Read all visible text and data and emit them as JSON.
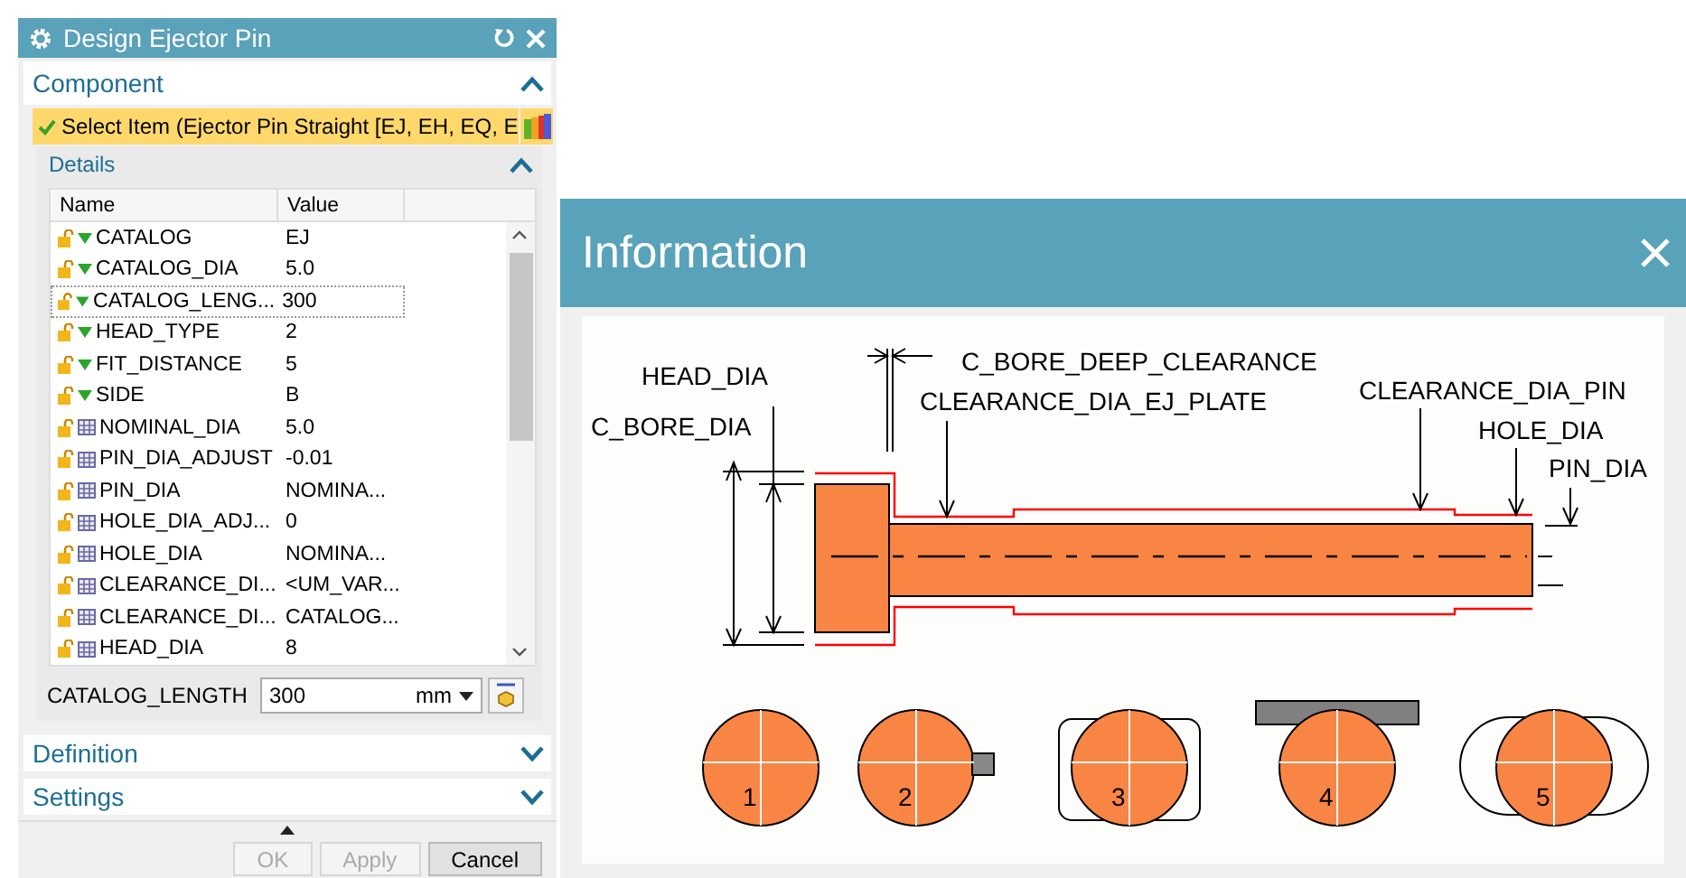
{
  "dialog": {
    "title": "Design Ejector Pin",
    "component": {
      "title": "Component",
      "expanded": true,
      "select_item": {
        "label": "Select Item (Ejector Pin Straight [EJ, EH, EQ, E",
        "done": true
      }
    },
    "details": {
      "title": "Details",
      "expanded": true,
      "columns": [
        "Name",
        "Value"
      ],
      "rows": [
        {
          "name": "CATALOG",
          "value": "EJ",
          "kind": "expression",
          "selected": false
        },
        {
          "name": "CATALOG_DIA",
          "value": "5.0",
          "kind": "expression",
          "selected": false
        },
        {
          "name": "CATALOG_LENG...",
          "value": "300",
          "kind": "expression",
          "selected": true
        },
        {
          "name": "HEAD_TYPE",
          "value": "2",
          "kind": "expression",
          "selected": false
        },
        {
          "name": "FIT_DISTANCE",
          "value": "5",
          "kind": "expression",
          "selected": false
        },
        {
          "name": "SIDE",
          "value": "B",
          "kind": "expression",
          "selected": false
        },
        {
          "name": "NOMINAL_DIA",
          "value": "5.0",
          "kind": "formula",
          "selected": false
        },
        {
          "name": "PIN_DIA_ADJUST",
          "value": "-0.01",
          "kind": "formula",
          "selected": false
        },
        {
          "name": "PIN_DIA",
          "value": "NOMINA...",
          "kind": "formula",
          "selected": false
        },
        {
          "name": "HOLE_DIA_ADJ...",
          "value": "0",
          "kind": "formula",
          "selected": false
        },
        {
          "name": "HOLE_DIA",
          "value": "NOMINA...",
          "kind": "formula",
          "selected": false
        },
        {
          "name": "CLEARANCE_DI...",
          "value": "<UM_VAR...",
          "kind": "formula",
          "selected": false
        },
        {
          "name": "CLEARANCE_DI...",
          "value": "CATALOG...",
          "kind": "formula",
          "selected": false
        },
        {
          "name": "HEAD_DIA",
          "value": "8",
          "kind": "formula",
          "selected": false
        }
      ],
      "field": {
        "label": "CATALOG_LENGTH",
        "value": "300",
        "unit": "mm"
      }
    },
    "sections": [
      {
        "title": "Definition",
        "expanded": false
      },
      {
        "title": "Settings",
        "expanded": false
      }
    ],
    "buttons": [
      {
        "label": "OK",
        "disabled": true
      },
      {
        "label": "Apply",
        "disabled": true
      },
      {
        "label": "Cancel",
        "disabled": false
      }
    ]
  },
  "information": {
    "title": "Information",
    "labels": [
      "C_BORE_DEEP_CLEARANCE",
      "HEAD_DIA",
      "CLEARANCE_DIA_EJ_PLATE",
      "CLEARANCE_DIA_PIN",
      "C_BORE_DIA",
      "HOLE_DIA",
      "PIN_DIA"
    ],
    "sections": [
      {
        "label": "1",
        "kind": "plain"
      },
      {
        "label": "2",
        "kind": "key"
      },
      {
        "label": "3",
        "kind": "flat-sides"
      },
      {
        "label": "4",
        "kind": "flat-top"
      },
      {
        "label": "5",
        "kind": "oval"
      }
    ]
  }
}
